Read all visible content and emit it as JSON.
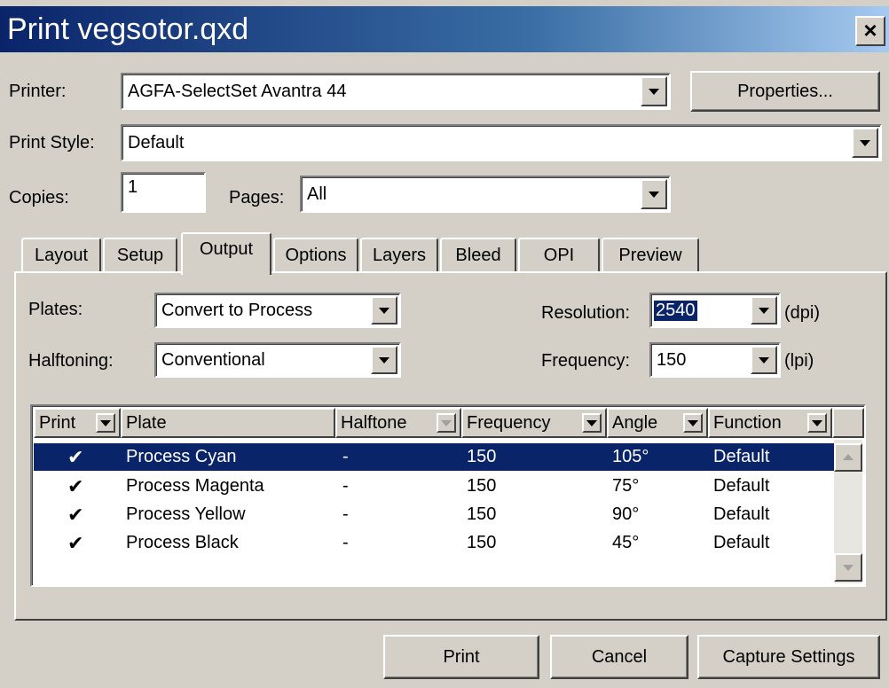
{
  "window": {
    "title": "Print vegsotor.qxd",
    "close_glyph": "×"
  },
  "printer": {
    "label": "Printer:",
    "value": "AGFA-SelectSet Avantra 44",
    "properties_label": "Properties..."
  },
  "print_style": {
    "label": "Print Style:",
    "value": "Default"
  },
  "copies": {
    "label": "Copies:",
    "value": "1"
  },
  "pages": {
    "label": "Pages:",
    "value": "All"
  },
  "tabs": [
    {
      "label": "Layout"
    },
    {
      "label": "Setup"
    },
    {
      "label": "Output",
      "active": true
    },
    {
      "label": "Options"
    },
    {
      "label": "Layers"
    },
    {
      "label": "Bleed"
    },
    {
      "label": "OPI"
    },
    {
      "label": "Preview"
    }
  ],
  "output": {
    "plates": {
      "label": "Plates:",
      "value": "Convert to Process"
    },
    "halftoning": {
      "label": "Halftoning:",
      "value": "Conventional"
    },
    "resolution": {
      "label": "Resolution:",
      "value": "2540",
      "unit": "(dpi)"
    },
    "frequency": {
      "label": "Frequency:",
      "value": "150",
      "unit": "(lpi)"
    }
  },
  "table": {
    "columns": [
      {
        "label": "Print"
      },
      {
        "label": "Plate"
      },
      {
        "label": "Halftone"
      },
      {
        "label": "Frequency"
      },
      {
        "label": "Angle"
      },
      {
        "label": "Function"
      }
    ],
    "rows": [
      {
        "print": "✔",
        "plate": "Process Cyan",
        "halftone": "-",
        "frequency": "150",
        "angle": "105°",
        "function": "Default",
        "selected": true
      },
      {
        "print": "✔",
        "plate": "Process Magenta",
        "halftone": "-",
        "frequency": "150",
        "angle": "75°",
        "function": "Default"
      },
      {
        "print": "✔",
        "plate": "Process Yellow",
        "halftone": "-",
        "frequency": "150",
        "angle": "90°",
        "function": "Default"
      },
      {
        "print": "✔",
        "plate": "Process Black",
        "halftone": "-",
        "frequency": "150",
        "angle": "45°",
        "function": "Default"
      }
    ]
  },
  "buttons": {
    "print": "Print",
    "cancel": "Cancel",
    "capture": "Capture Settings"
  },
  "colors": {
    "face": "#d4d0c8",
    "selection": "#0a246a",
    "title_start": "#0a246a",
    "title_end": "#a6caf0"
  }
}
